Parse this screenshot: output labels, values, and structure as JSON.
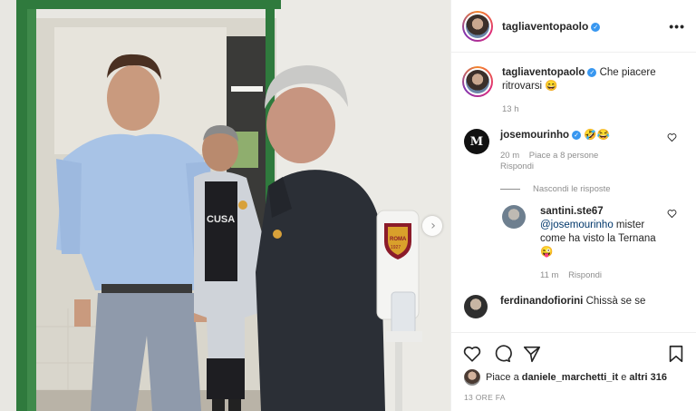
{
  "post": {
    "author": "tagliaventopaolo",
    "more_label": "•••",
    "nav_next_glyph": "›"
  },
  "photo_text": {
    "jersey": "CUSA",
    "badge_team": "ROMA",
    "badge_year": "1927"
  },
  "caption": {
    "author": "tagliaventopaolo",
    "text": "Che piacere ritrovarsi 😄",
    "time": "13 h"
  },
  "comments": [
    {
      "author": "josemourinho",
      "text": "🤣😂",
      "time": "20 m",
      "likes": "Piace a 8 persone",
      "reply": "Rispondi",
      "hide_replies": "Nascondi le risposte"
    },
    {
      "author": "santini.ste67",
      "mention": "@josemourinho",
      "text": "mister come ha visto la Ternana 😜",
      "time": "11 m",
      "reply": "Rispondi"
    },
    {
      "author": "ferdinandofiorini",
      "text": "Chissà se se"
    }
  ],
  "likes_line": {
    "prefix": "Piace a",
    "user": "daniele_marchetti_it",
    "middle": "e",
    "others": "altri 316"
  },
  "timestamp": "13 ORE FA",
  "colors": {
    "verified": "#3897f0",
    "muted": "#8e8e8e",
    "text": "#262626",
    "door_green": "#2f7a3d"
  }
}
